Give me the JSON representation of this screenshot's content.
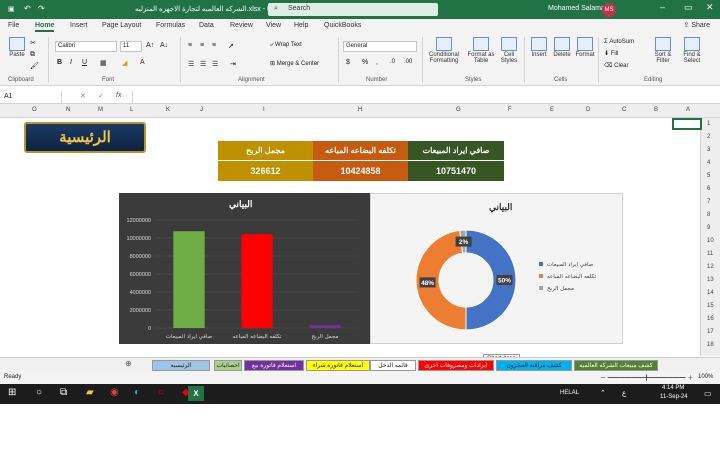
{
  "window": {
    "title": "الشركه العالميه لتجارة الاجهزه المنزليه.xlsx - Excel",
    "search": "Search",
    "user": "Mohamed Salama",
    "initials": "MS"
  },
  "tabs": [
    "File",
    "Home",
    "Insert",
    "Page Layout",
    "Formulas",
    "Data",
    "Review",
    "View",
    "Help",
    "QuickBooks"
  ],
  "share": "Share",
  "ribbon": {
    "paste": "Paste",
    "clipboard": "Clipboard",
    "font_name": "Calibri",
    "font_size": "11",
    "font": "Font",
    "wrap": "Wrap Text",
    "merge": "Merge & Center",
    "alignment": "Alignment",
    "number_format": "General",
    "number": "Number",
    "cond": "Conditional Formatting",
    "format_table": "Format as Table",
    "cell_styles": "Cell Styles",
    "styles": "Styles",
    "insert": "Insert",
    "delete": "Delete",
    "format": "Format",
    "cells": "Cells",
    "autosum": "AutoSum",
    "fill": "Fill",
    "clear": "Clear",
    "sort": "Sort & Filter",
    "find": "Find & Select",
    "editing": "Editing"
  },
  "namebox": "A1",
  "fx": "fx",
  "columns": [
    "A",
    "B",
    "C",
    "D",
    "E",
    "F",
    "G",
    "H",
    "I",
    "J",
    "K",
    "L",
    "M",
    "N",
    "O"
  ],
  "rows": [
    "1",
    "2",
    "3",
    "4",
    "5",
    "6",
    "7",
    "8",
    "9",
    "10",
    "11",
    "12",
    "13",
    "14",
    "15",
    "16",
    "17",
    "18"
  ],
  "logo": "الرئيسية",
  "kpi": {
    "h1": "صافي ايراد المبيعات",
    "h2": "تكلفه البضاعه المباعه",
    "h3": "مجمل الربح",
    "v1": "10751470",
    "v2": "10424858",
    "v3": "326612",
    "c1": "#375623",
    "c2": "#c55a11",
    "c3": "#bf9000"
  },
  "chart_data": [
    {
      "type": "bar",
      "title": "البياني",
      "categories": [
        "صافي ايراد المبيعات",
        "تكلفه البضاعه المباعه",
        "مجمل الربح"
      ],
      "values": [
        10751470,
        10424858,
        326612
      ],
      "ylim": [
        0,
        12000000
      ],
      "yticks": [
        "12000000",
        "10000000",
        "8000000",
        "6000000",
        "4000000",
        "2000000",
        "0"
      ],
      "colors": [
        "#70ad47",
        "#ff0000",
        "#7030a0"
      ]
    },
    {
      "type": "pie",
      "title": "البياني",
      "categories": [
        "صافي ايراد المبيعات",
        "تكلفه البضاعه المباعه",
        "مجمل الربح"
      ],
      "values": [
        50,
        48,
        2
      ],
      "labels": [
        "50%",
        "48%",
        "2%"
      ],
      "colors": [
        "#4472c4",
        "#ed7d31",
        "#a5a5a5"
      ]
    }
  ],
  "tooltip": "Chart Area",
  "sheets": [
    {
      "label": "الرئيسيه",
      "bg": "#9dc3e6"
    },
    {
      "label": "احصائيات ماليه",
      "bg": "#a9d08e"
    },
    {
      "label": "استعلام فاتورة بيع",
      "bg": "#7030a0"
    },
    {
      "label": "استعلام فاتورة شراء",
      "bg": "#ffff00"
    },
    {
      "label": "قائمه الدخل",
      "bg": "#ffffff"
    },
    {
      "label": "ايرادات ومصروفات اخرى",
      "bg": "#ff0000"
    },
    {
      "label": "كشف مراقبه المخزون",
      "bg": "#00b0f0"
    },
    {
      "label": "كشف مبيعات الشركه العالميه",
      "bg": "#548235"
    }
  ],
  "status": {
    "ready": "Ready",
    "zoom": "100%"
  },
  "taskbar": {
    "lang": "HELAL",
    "kb": "ع",
    "time": "4:14 PM",
    "date": "11-Sep-24"
  }
}
